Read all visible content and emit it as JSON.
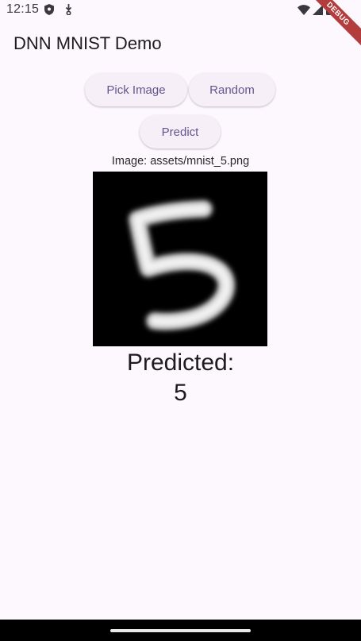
{
  "status_bar": {
    "time": "12:15",
    "left_icons": [
      "shield-icon",
      "download-icon"
    ],
    "right_icons": [
      "wifi-icon",
      "signal-icon",
      "battery-icon"
    ]
  },
  "debug_banner": "DEBUG",
  "app_bar": {
    "title": "DNN MNIST Demo"
  },
  "buttons": {
    "pick_image": "Pick Image",
    "random": "Random",
    "predict": "Predict"
  },
  "image": {
    "path_label": "Image: assets/mnist_5.png"
  },
  "result": {
    "label": "Predicted:",
    "value": "5"
  },
  "colors": {
    "background": "#fdf7fe",
    "button_bg": "#f6eff8",
    "button_text": "#65558f",
    "debug_banner": "#b33c3c"
  }
}
